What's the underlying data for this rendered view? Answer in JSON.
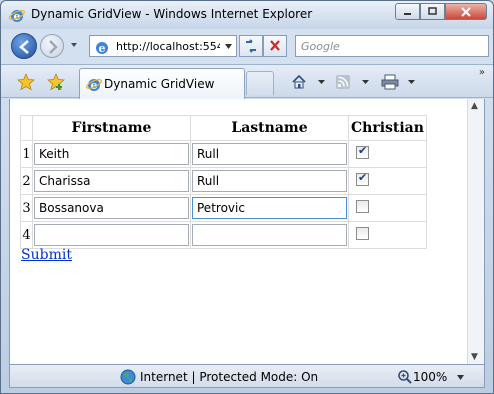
{
  "window": {
    "title": "Dynamic GridView - Windows Internet Explorer"
  },
  "address": {
    "url": "http://localhost:554"
  },
  "search": {
    "placeholder": "Google"
  },
  "tab": {
    "label": "Dynamic GridView"
  },
  "grid": {
    "headers": {
      "firstname": "Firstname",
      "lastname": "Lastname",
      "christian": "Christian"
    },
    "rows": [
      {
        "num": "1",
        "firstname": "Keith",
        "lastname": "Rull",
        "christian": true
      },
      {
        "num": "2",
        "firstname": "Charissa",
        "lastname": "Rull",
        "christian": true
      },
      {
        "num": "3",
        "firstname": "Bossanova",
        "lastname": "Petrovic",
        "christian": false
      },
      {
        "num": "4",
        "firstname": "",
        "lastname": "",
        "christian": false
      }
    ]
  },
  "submit_label": "Submit",
  "status": {
    "zone": "Internet | Protected Mode: On",
    "zoom": "100%"
  },
  "icons": [
    "ie-logo-icon",
    "back-arrow-icon",
    "forward-arrow-icon",
    "refresh-icon",
    "stop-icon",
    "favorites-star-icon",
    "add-favorite-icon",
    "home-icon",
    "feeds-icon",
    "print-icon",
    "globe-icon",
    "zoom-icon"
  ]
}
